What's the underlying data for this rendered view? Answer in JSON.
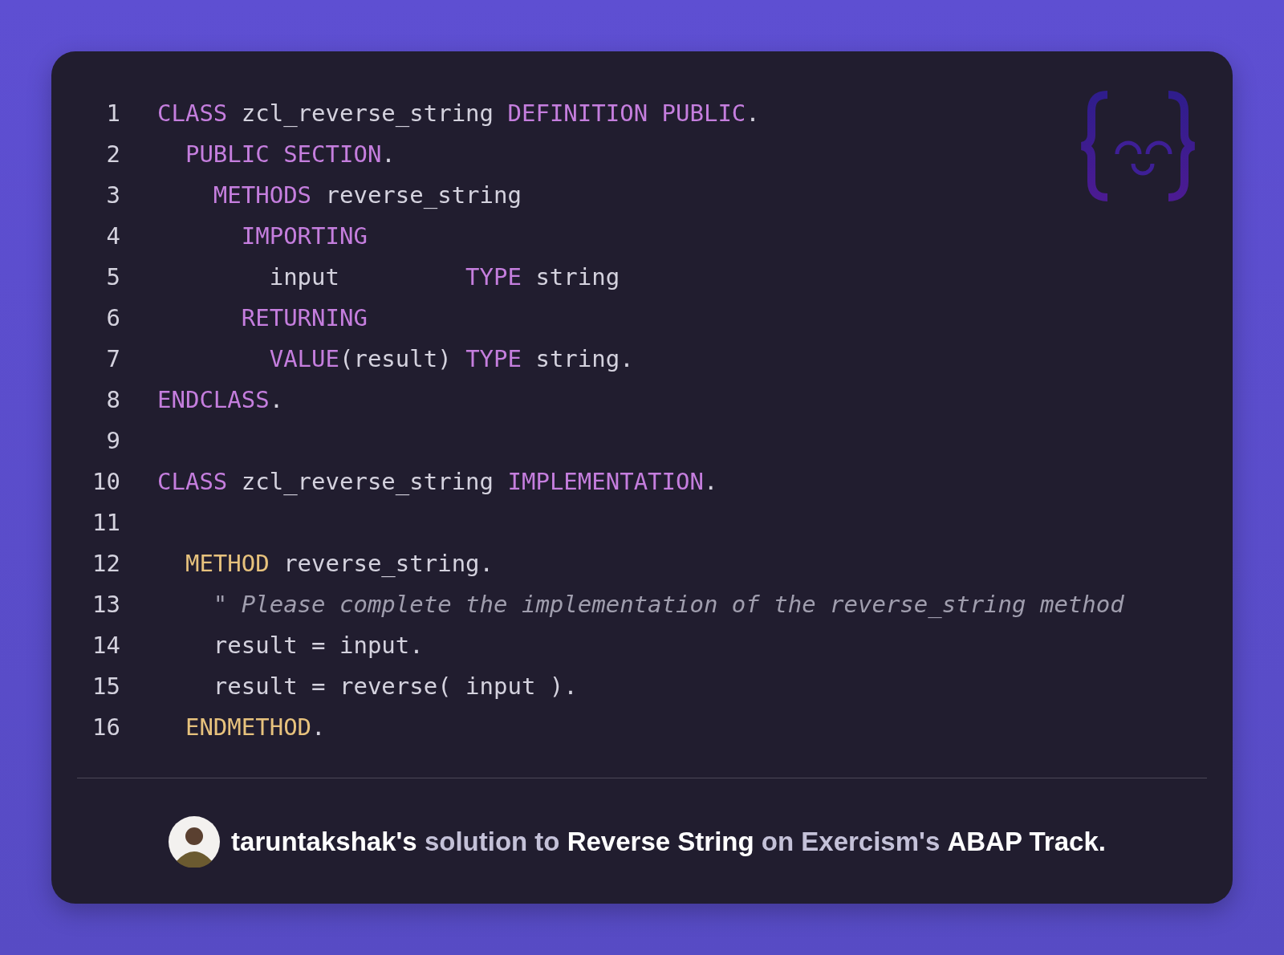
{
  "code": {
    "lines": [
      {
        "number": "1",
        "tokens": [
          {
            "kind": "keyword",
            "text": "CLASS"
          },
          {
            "kind": "plain",
            "text": " zcl_reverse_string "
          },
          {
            "kind": "keyword",
            "text": "DEFINITION PUBLIC"
          },
          {
            "kind": "plain",
            "text": "."
          }
        ]
      },
      {
        "number": "2",
        "tokens": [
          {
            "kind": "keyword",
            "text": "  PUBLIC SECTION"
          },
          {
            "kind": "plain",
            "text": "."
          }
        ]
      },
      {
        "number": "3",
        "tokens": [
          {
            "kind": "keyword",
            "text": "    METHODS"
          },
          {
            "kind": "plain",
            "text": " reverse_string"
          }
        ]
      },
      {
        "number": "4",
        "tokens": [
          {
            "kind": "keyword",
            "text": "      IMPORTING"
          }
        ]
      },
      {
        "number": "5",
        "tokens": [
          {
            "kind": "plain",
            "text": "        input         "
          },
          {
            "kind": "keyword",
            "text": "TYPE"
          },
          {
            "kind": "plain",
            "text": " string"
          }
        ]
      },
      {
        "number": "6",
        "tokens": [
          {
            "kind": "keyword",
            "text": "      RETURNING"
          }
        ]
      },
      {
        "number": "7",
        "tokens": [
          {
            "kind": "keyword",
            "text": "        VALUE"
          },
          {
            "kind": "plain",
            "text": "(result) "
          },
          {
            "kind": "keyword",
            "text": "TYPE"
          },
          {
            "kind": "plain",
            "text": " string."
          }
        ]
      },
      {
        "number": "8",
        "tokens": [
          {
            "kind": "keyword",
            "text": "ENDCLASS"
          },
          {
            "kind": "plain",
            "text": "."
          }
        ]
      },
      {
        "number": "9"
      },
      {
        "number": "10",
        "tokens": [
          {
            "kind": "keyword",
            "text": "CLASS"
          },
          {
            "kind": "plain",
            "text": " zcl_reverse_string "
          },
          {
            "kind": "keyword",
            "text": "IMPLEMENTATION"
          },
          {
            "kind": "plain",
            "text": "."
          }
        ]
      },
      {
        "number": "11"
      },
      {
        "number": "12",
        "tokens": [
          {
            "kind": "method",
            "text": "  METHOD"
          },
          {
            "kind": "plain",
            "text": " reverse_string."
          }
        ]
      },
      {
        "number": "13",
        "tokens": [
          {
            "kind": "comment",
            "text": "    \" Please complete the implementation of the reverse_string method"
          }
        ]
      },
      {
        "number": "14",
        "tokens": [
          {
            "kind": "plain",
            "text": "    result = input."
          }
        ]
      },
      {
        "number": "15",
        "tokens": [
          {
            "kind": "plain",
            "text": "    result = reverse( input )."
          }
        ]
      },
      {
        "number": "16",
        "tokens": [
          {
            "kind": "method",
            "text": "  ENDMETHOD"
          },
          {
            "kind": "plain",
            "text": "."
          }
        ]
      }
    ]
  },
  "footer": {
    "caption": "**taruntakshak's** solution to **Reverse String** on Exercism's **ABAP Track.**"
  }
}
